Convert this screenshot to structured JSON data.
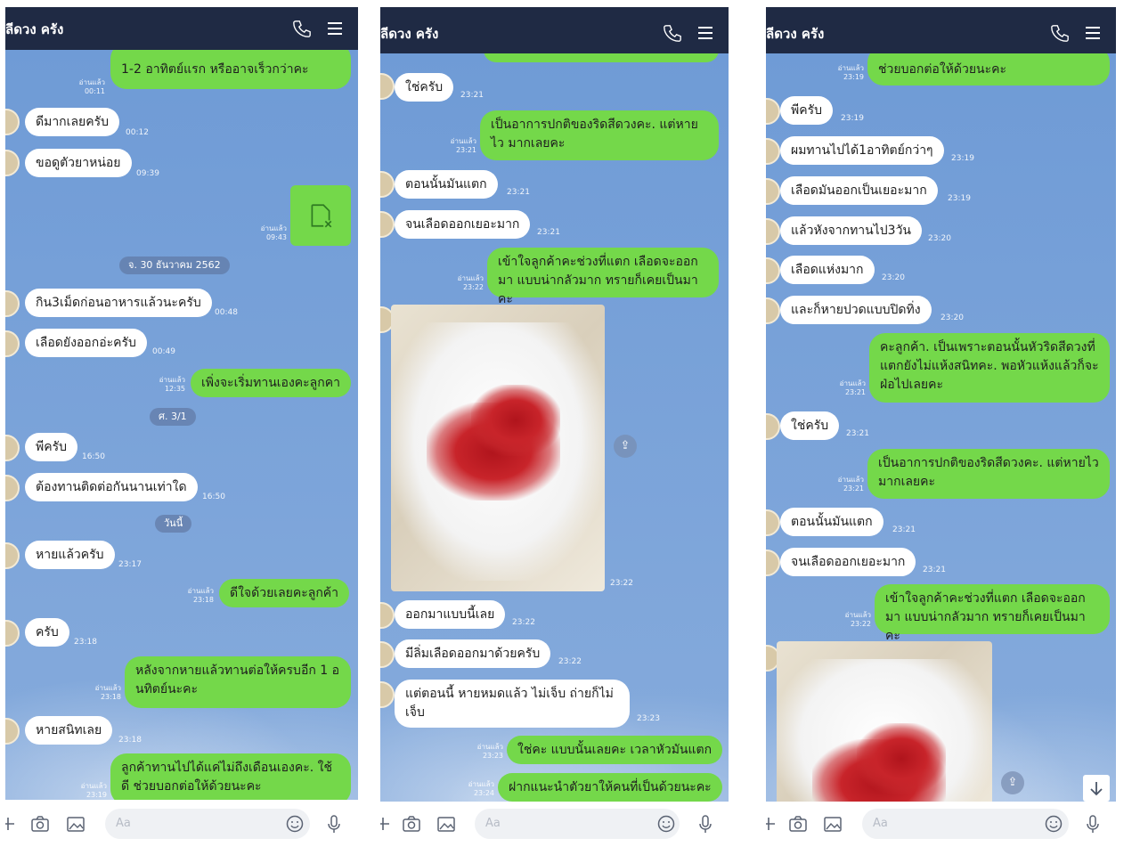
{
  "colors": {
    "header": "#1f2a44",
    "bubble_out": "#74d84a",
    "bubble_in": "#ffffff",
    "chat_bg": "#7ca3d9"
  },
  "panels": [
    {
      "title": "ลีดวง ครัง",
      "input_placeholder": "Aa",
      "top_fragment": {
        "text": "1-2 อาทิตย์แรก หรืออาจเร็วกว่าคะ",
        "read": "อ่านแล้ว",
        "time": "00:11"
      },
      "messages": [
        {
          "dir": "in",
          "text": "ดีมากเลยครับ",
          "time": "00:12"
        },
        {
          "dir": "in",
          "text": "ขอดูตัวยาหน่อย",
          "time": "09:39"
        },
        {
          "dir": "out",
          "text": "",
          "read": "อ่านแล้ว",
          "time": "09:43"
        },
        {
          "dir": "in",
          "text": "กิน3เม็ดก่อนอาหารแล้วนะครับ",
          "time": "00:48"
        },
        {
          "dir": "in",
          "text": "เลือดยังออกอ่ะครับ",
          "time": "00:49"
        },
        {
          "dir": "out",
          "text": "เพิ่งจะเริ่มทานเองคะลูกคา",
          "read": "อ่านแล้ว",
          "time": "12:35"
        },
        {
          "dir": "in",
          "text": "พีครับ",
          "time": "16:50"
        },
        {
          "dir": "in",
          "text": "ต้องทานติดต่อกันนานเท่าใด",
          "time": "16:50"
        },
        {
          "dir": "in",
          "text": "หายแล้วครับ",
          "time": "23:17"
        },
        {
          "dir": "out",
          "text": "ดีใจด้วยเลยคะลูกค้า",
          "read": "อ่านแล้ว",
          "time": "23:18"
        },
        {
          "dir": "in",
          "text": "ครับ",
          "time": "23:18"
        },
        {
          "dir": "out",
          "text": "หลังจากหายแล้วทานต่อให้ครบอีก 1 อ นทิตย์นะคะ",
          "read": "อ่านแล้ว",
          "time": "23:18"
        },
        {
          "dir": "in",
          "text": "หายสนิทเลย",
          "time": "23:18"
        },
        {
          "dir": "out",
          "text": "ลูกค้าทานไปได้แค่ไม่ถึงเดือนเองคะ. ใช้ดี ช่วยบอกต่อให้ด้วยนะคะ",
          "read": "อ่านแล้ว",
          "time": "23:19"
        }
      ],
      "dates": [
        "จ. 30 ธันวาคม 2562",
        "ศ. 3/1",
        "วันนี้"
      ]
    },
    {
      "title": "ลีดวง ครัง",
      "input_placeholder": "Aa",
      "messages": [
        {
          "dir": "in",
          "text": "ใช่ครับ",
          "time": "23:21"
        },
        {
          "dir": "out",
          "text": "เป็นอาการปกติของริดสีดวงคะ. แต่หายไว มากเลยคะ",
          "read": "อ่านแล้ว",
          "time": "23:21"
        },
        {
          "dir": "in",
          "text": "ตอนนั้นมันแตก",
          "time": "23:21"
        },
        {
          "dir": "in",
          "text": "จนเลือดออกเยอะมาก",
          "time": "23:21"
        },
        {
          "dir": "out",
          "text": "เข้าใจลูกค้าคะช่วงที่แตก เลือดจะออกมา แบบน่ากลัวมาก ทรายก็เคยเป็นมาคะ",
          "read": "อ่านแล้ว",
          "time": "23:22"
        },
        {
          "dir": "in",
          "text": "",
          "time": "23:22"
        },
        {
          "dir": "in",
          "text": "ออกมาแบบนี้เลย",
          "time": "23:22"
        },
        {
          "dir": "in",
          "text": "มีลิ่มเลือดออกมาด้วยครับ",
          "time": "23:22"
        },
        {
          "dir": "in",
          "text": "แต่ตอนนี้ หายหมดแล้ว ไม่เจ็บ ถ่ายก็ไม่ เจ็บ",
          "time": "23:23"
        },
        {
          "dir": "out",
          "text": "ใช่คะ แบบนั้นเลยคะ เวลาหัวมันแตก",
          "read": "อ่านแล้ว",
          "time": "23:23"
        },
        {
          "dir": "out",
          "text": "ฝากแนะนำตัวยาให้คนที่เป็นด้วยนะคะ",
          "read": "อ่านแล้ว",
          "time": "23:24"
        }
      ]
    },
    {
      "title": "ลีดวง ครัง",
      "input_placeholder": "Aa",
      "top_fragment": {
        "text": "ช่วยบอกต่อให้ด้วยนะคะ",
        "read": "อ่านแล้ว",
        "time": "23:19"
      },
      "messages": [
        {
          "dir": "in",
          "text": "พีครับ",
          "time": "23:19"
        },
        {
          "dir": "in",
          "text": "ผมทานไปได้1อาทิตย์กว่าๆ",
          "time": "23:19"
        },
        {
          "dir": "in",
          "text": "เลือดมันออกเป็นเยอะมาก",
          "time": "23:19"
        },
        {
          "dir": "in",
          "text": "แล้วหังจากทานไป3วัน",
          "time": "23:20"
        },
        {
          "dir": "in",
          "text": "เลือดแห่งมาก",
          "time": "23:20"
        },
        {
          "dir": "in",
          "text": "และก็หายปวดแบบปิดทิ่ง",
          "time": "23:20"
        },
        {
          "dir": "out",
          "text": "คะลูกค้า. เป็นเพราะตอนนั้นหัวริดสีดวงที่ แตกยังไม่แห้งสนิทคะ. พอหัวแห้งแล้วก็จะ ฝ่อไปเลยคะ",
          "read": "อ่านแล้ว",
          "time": "23:21"
        },
        {
          "dir": "in",
          "text": "ใช่ครับ",
          "time": "23:21"
        },
        {
          "dir": "out",
          "text": "เป็นอาการปกติของริดสีดวงคะ. แต่หายไว มากเลยคะ",
          "read": "อ่านแล้ว",
          "time": "23:21"
        },
        {
          "dir": "in",
          "text": "ตอนนั้นมันแตก",
          "time": "23:21"
        },
        {
          "dir": "in",
          "text": "จนเลือดออกเยอะมาก",
          "time": "23:21"
        },
        {
          "dir": "out",
          "text": "เข้าใจลูกค้าคะช่วงที่แตก เลือดจะออกมา แบบน่ากลัวมาก ทรายก็เคยเป็นมาคะ",
          "read": "อ่านแล้ว",
          "time": "23:22"
        }
      ]
    }
  ]
}
